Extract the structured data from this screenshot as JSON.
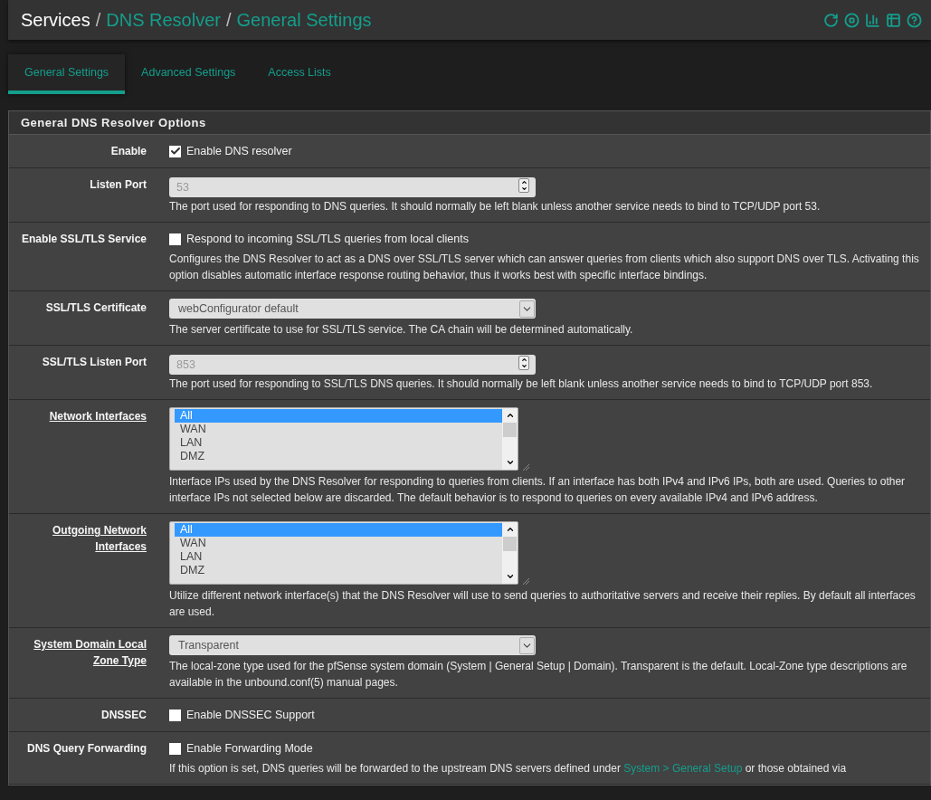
{
  "breadcrumb": [
    {
      "text": "Services",
      "kind": "plain"
    },
    {
      "text": "/",
      "kind": "separator"
    },
    {
      "text": "DNS Resolver",
      "kind": "link"
    },
    {
      "text": "/",
      "kind": "separator"
    },
    {
      "text": "General Settings",
      "kind": "current"
    }
  ],
  "header_icons": [
    {
      "kind": "restart"
    },
    {
      "kind": "stop"
    },
    {
      "kind": "chart"
    },
    {
      "kind": "log"
    },
    {
      "kind": "help"
    }
  ],
  "tabs": [
    {
      "label": "General Settings",
      "selected": true
    },
    {
      "label": "Advanced Settings",
      "selected": false
    },
    {
      "label": "Access Lists",
      "selected": false
    }
  ],
  "panel": {
    "title": "General DNS Resolver Options",
    "rows": [
      {
        "label": "Enable",
        "underlined": false,
        "kind": "checkbox",
        "checked": true,
        "option": "Enable DNS resolver"
      },
      {
        "label": "Listen Port",
        "underlined": false,
        "kind": "number",
        "placeholder": "53",
        "help": [
          {
            "kind": "text",
            "text": "The port used for responding to DNS queries. It should normally be left blank unless another service needs to bind to TCP/UDP port 53."
          }
        ]
      },
      {
        "label": "Enable SSL/TLS Service",
        "underlined": false,
        "kind": "checkbox",
        "checked": false,
        "option": "Respond to incoming SSL/TLS queries from local clients",
        "help": [
          {
            "kind": "text",
            "text": "Configures the DNS Resolver to act as a DNS over SSL/TLS server which can answer queries from clients which also support DNS over TLS. Activating this option disables automatic interface response routing behavior, thus it works best with specific interface bindings."
          }
        ]
      },
      {
        "label": "SSL/TLS Certificate",
        "underlined": false,
        "kind": "select",
        "value": "webConfigurator default",
        "help": [
          {
            "kind": "text",
            "text": "The server certificate to use for SSL/TLS service. The CA chain will be determined automatically."
          }
        ]
      },
      {
        "label": "SSL/TLS Listen Port",
        "underlined": false,
        "kind": "number",
        "placeholder": "853",
        "help": [
          {
            "kind": "text",
            "text": "The port used for responding to SSL/TLS DNS queries. It should normally be left blank unless another service needs to bind to TCP/UDP port 853."
          }
        ]
      },
      {
        "label": "Network Interfaces",
        "underlined": true,
        "kind": "listbox",
        "options": [
          {
            "text": "All",
            "selected": true
          },
          {
            "text": "WAN",
            "selected": false
          },
          {
            "text": "LAN",
            "selected": false
          },
          {
            "text": "DMZ",
            "selected": false
          }
        ],
        "help": [
          {
            "kind": "text",
            "text": "Interface IPs used by the DNS Resolver for responding to queries from clients. If an interface has both IPv4 and IPv6 IPs, both are used. Queries to other interface IPs not selected below are discarded. The default behavior is to respond to queries on every available IPv4 and IPv6 address."
          }
        ]
      },
      {
        "label": "Outgoing Network Interfaces",
        "underlined": true,
        "kind": "listbox",
        "options": [
          {
            "text": "All",
            "selected": true
          },
          {
            "text": "WAN",
            "selected": false
          },
          {
            "text": "LAN",
            "selected": false
          },
          {
            "text": "DMZ",
            "selected": false
          }
        ],
        "help": [
          {
            "kind": "text",
            "text": "Utilize different network interface(s) that the DNS Resolver will use to send queries to authoritative servers and receive their replies. By default all interfaces are used."
          }
        ]
      },
      {
        "label": "System Domain Local Zone Type",
        "underlined": true,
        "kind": "select",
        "value": "Transparent",
        "help": [
          {
            "kind": "text",
            "text": "The local-zone type used for the pfSense system domain (System | General Setup | Domain). Transparent is the default. Local-Zone type descriptions are available in the unbound.conf(5) manual pages."
          }
        ]
      },
      {
        "label": "DNSSEC",
        "underlined": false,
        "kind": "checkbox",
        "checked": false,
        "option": "Enable DNSSEC Support"
      },
      {
        "label": "DNS Query Forwarding",
        "underlined": false,
        "kind": "checkbox",
        "checked": false,
        "option": "Enable Forwarding Mode",
        "help": [
          {
            "kind": "text",
            "text": "If this option is set, DNS queries will be forwarded to the upstream DNS servers defined under "
          },
          {
            "kind": "link",
            "text": "System > General Setup"
          },
          {
            "kind": "text",
            "text": " or those obtained via"
          }
        ]
      }
    ]
  }
}
